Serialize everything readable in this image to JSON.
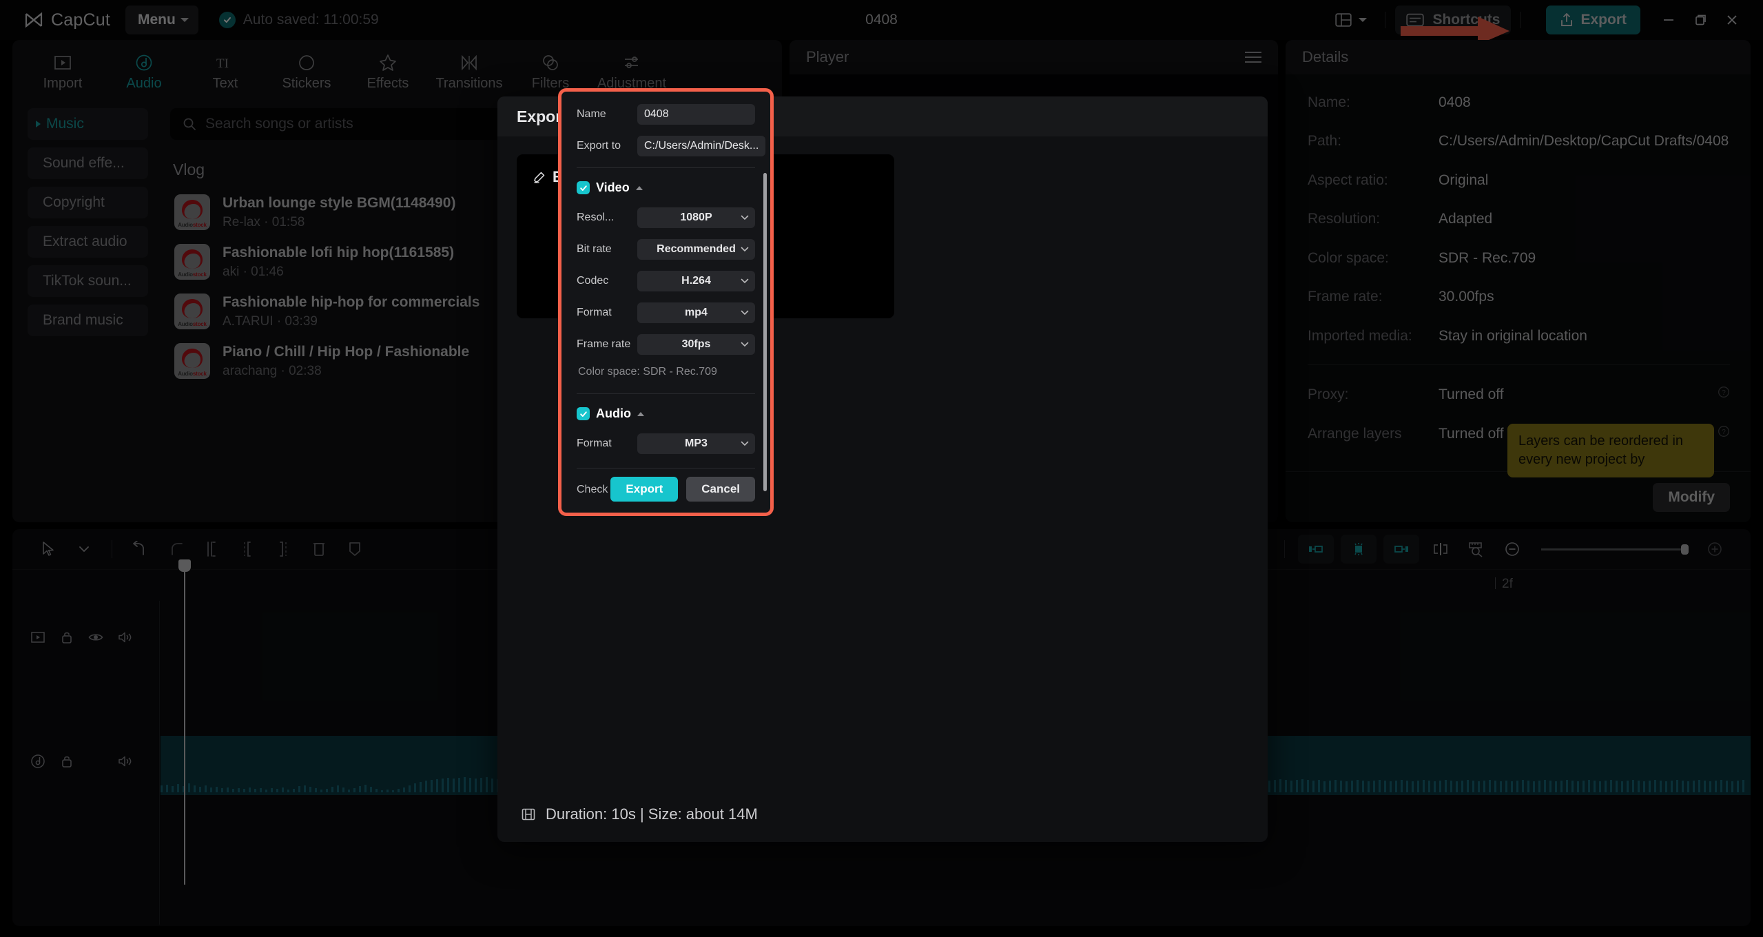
{
  "titlebar": {
    "brand": "CapCut",
    "menu_label": "Menu",
    "autosave": "Auto saved: 11:00:59",
    "project_title": "0408",
    "shortcuts_label": "Shortcuts",
    "export_label": "Export",
    "accent": "#0e6c70",
    "arrow_color": "#f4604a"
  },
  "tabs": [
    {
      "label": "Import",
      "icon": "import-icon",
      "active": false
    },
    {
      "label": "Audio",
      "icon": "audio-note-icon",
      "active": true
    },
    {
      "label": "Text",
      "icon": "text-icon",
      "active": false
    },
    {
      "label": "Stickers",
      "icon": "sticker-icon",
      "active": false
    },
    {
      "label": "Effects",
      "icon": "effects-star-icon",
      "active": false
    },
    {
      "label": "Transitions",
      "icon": "transitions-icon",
      "active": false
    },
    {
      "label": "Filters",
      "icon": "filters-icon",
      "active": false
    },
    {
      "label": "Adjustment",
      "icon": "adjustment-sliders-icon",
      "active": false
    }
  ],
  "categories": [
    {
      "label": "Music",
      "active": true
    },
    {
      "label": "Sound effe...",
      "active": false
    },
    {
      "label": "Copyright",
      "active": false
    },
    {
      "label": "Extract audio",
      "active": false
    },
    {
      "label": "TikTok soun...",
      "active": false
    },
    {
      "label": "Brand music",
      "active": false
    }
  ],
  "search": {
    "placeholder": "Search songs or artists",
    "value": ""
  },
  "music": {
    "group_title": "Vlog",
    "thumb_brand_prefix": "Audio",
    "thumb_brand_suffix": "stock",
    "items": [
      {
        "title": "Urban lounge style BGM(1148490)",
        "sub": "Re-lax · 01:58"
      },
      {
        "title": "Fashionable lofi hip hop(1161585)",
        "sub": "aki · 01:46"
      },
      {
        "title": "Fashionable hip-hop for commercials",
        "sub": "A.TARUI · 03:39"
      },
      {
        "title": "Piano / Chill / Hip Hop / Fashionable",
        "sub": "arachang · 02:38"
      }
    ]
  },
  "player": {
    "title": "Player"
  },
  "details": {
    "title": "Details",
    "rows": [
      {
        "key": "Name:",
        "value": "0408"
      },
      {
        "key": "Path:",
        "value": "C:/Users/Admin/Desktop/CapCut Drafts/0408"
      },
      {
        "key": "Aspect ratio:",
        "value": "Original"
      },
      {
        "key": "Resolution:",
        "value": "Adapted"
      },
      {
        "key": "Color space:",
        "value": "SDR - Rec.709"
      },
      {
        "key": "Frame rate:",
        "value": "30.00fps"
      },
      {
        "key": "Imported media:",
        "value": "Stay in original location"
      }
    ],
    "rows2": [
      {
        "key": "Proxy:",
        "value": "Turned off"
      },
      {
        "key": "Arrange layers",
        "value": "Turned off"
      }
    ],
    "tooltip": "Layers can be reordered in every new project by",
    "modify_label": "Modify"
  },
  "timeline": {
    "ruler_label": "2f",
    "zoom_out_icon": "zoom-out-icon",
    "zoom_in_icon": "zoom-in-icon"
  },
  "export_dialog": {
    "title": "Export",
    "edit_cover_label": "Edit cover",
    "footer_info": "Duration: 10s | Size: about 14M",
    "name_label": "Name",
    "name_value": "0408",
    "export_to_label": "Export to",
    "export_to_value": "C:/Users/Admin/Desk...",
    "video_section": "Video",
    "audio_section": "Audio",
    "fields": [
      {
        "label": "Resol...",
        "value": "1080P"
      },
      {
        "label": "Bit rate",
        "value": "Recommended"
      },
      {
        "label": "Codec",
        "value": "H.264"
      },
      {
        "label": "Format",
        "value": "mp4"
      },
      {
        "label": "Frame rate",
        "value": "30fps"
      }
    ],
    "color_space_note": "Color space: SDR - Rec.709",
    "audio_format_label": "Format",
    "audio_format_value": "MP3",
    "check_copyright_label": "Check copyright?",
    "copyright_toggle_on": false,
    "export_label": "Export",
    "cancel_label": "Cancel",
    "highlight_color": "#f4604a",
    "accent_color": "#17c5cd"
  }
}
